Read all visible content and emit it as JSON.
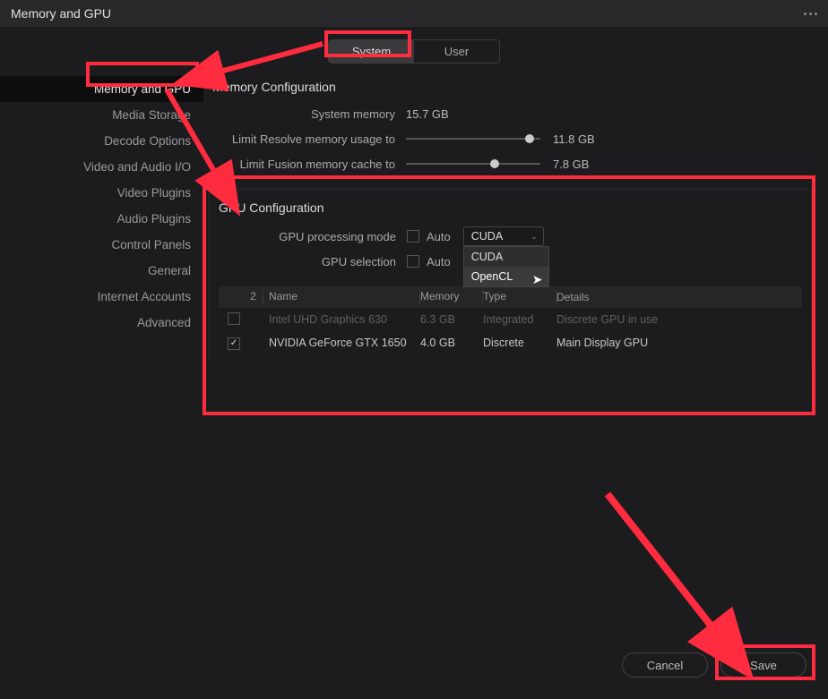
{
  "title": "Memory and GPU",
  "tabs": {
    "system": "System",
    "user": "User"
  },
  "sidebar": {
    "items": [
      {
        "label": "Memory and GPU"
      },
      {
        "label": "Media Storage"
      },
      {
        "label": "Decode Options"
      },
      {
        "label": "Video and Audio I/O"
      },
      {
        "label": "Video Plugins"
      },
      {
        "label": "Audio Plugins"
      },
      {
        "label": "Control Panels"
      },
      {
        "label": "General"
      },
      {
        "label": "Internet Accounts"
      },
      {
        "label": "Advanced"
      }
    ]
  },
  "memory": {
    "title": "Memory Configuration",
    "system_label": "System memory",
    "system_value": "15.7 GB",
    "resolve_label": "Limit Resolve memory usage to",
    "resolve_value": "11.8 GB",
    "fusion_label": "Limit Fusion memory cache to",
    "fusion_value": "7.8 GB"
  },
  "gpu": {
    "title": "GPU Configuration",
    "mode_label": "GPU processing mode",
    "auto_label": "Auto",
    "mode_value": "CUDA",
    "options": [
      "CUDA",
      "OpenCL"
    ],
    "selection_label": "GPU selection",
    "table": {
      "count": "2",
      "headers": {
        "name": "Name",
        "memory": "Memory",
        "type": "Type",
        "details": "Details"
      },
      "rows": [
        {
          "name": "Intel UHD Graphics 630",
          "memory": "6.3 GB",
          "type": "Integrated",
          "details": "Discrete GPU in use",
          "checked": false,
          "disabled": true
        },
        {
          "name": "NVIDIA GeForce GTX 1650",
          "memory": "4.0 GB",
          "type": "Discrete",
          "details": "Main Display GPU",
          "checked": true,
          "disabled": false
        }
      ]
    }
  },
  "footer": {
    "cancel": "Cancel",
    "save": "Save"
  }
}
